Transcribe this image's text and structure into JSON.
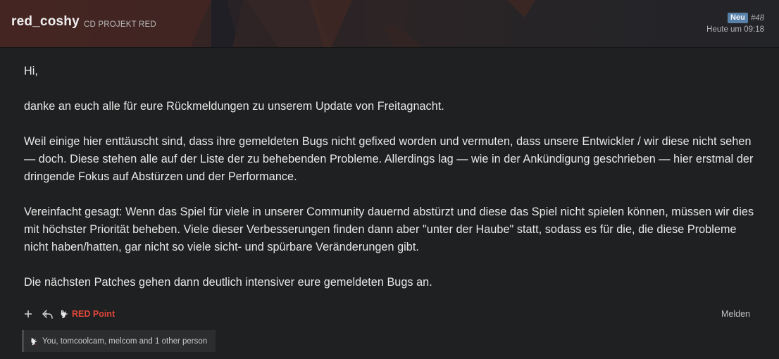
{
  "header": {
    "username": "red_coshy",
    "user_title": "CD PROJEKT RED",
    "badge_new": "Neu",
    "post_number": "#48",
    "timestamp": "Heute um 09:18"
  },
  "post": {
    "paragraphs": [
      "Hi,",
      "danke an euch alle für eure Rückmeldungen zu unserem Update von Freitagnacht.",
      "Weil einige hier enttäuscht sind, dass ihre gemeldeten Bugs nicht gefixed worden und vermuten, dass unsere Entwickler / wir diese nicht sehen — doch. Diese stehen alle auf der Liste der zu behebenden Probleme. Allerdings lag — wie in der Ankündigung geschrieben — hier erstmal der dringende Fokus auf Abstürzen und der Performance.",
      "Vereinfacht gesagt: Wenn das Spiel für viele in unserer Community dauernd abstürzt und diese das Spiel nicht spielen können, müssen wir dies mit höchster Priorität beheben. Viele dieser Verbesserungen finden dann aber \"unter der Haube\" statt, sodass es für die, die diese Probleme nicht haben/hatten, gar nicht so viele sicht- und spürbare Veränderungen gibt.",
      "Die nächsten Patches gehen dann deutlich intensiver eure gemeldeten Bugs an."
    ]
  },
  "actions": {
    "plus_icon": "plus-icon",
    "reply_icon": "reply-icon",
    "red_point_label": "RED Point",
    "report_label": "Melden"
  },
  "reactions": {
    "text": "You, tomcoolcam, melcom and 1 other person"
  },
  "colors": {
    "accent_red": "#e0473a",
    "badge_blue": "#5680a8",
    "background": "#1f2021"
  }
}
